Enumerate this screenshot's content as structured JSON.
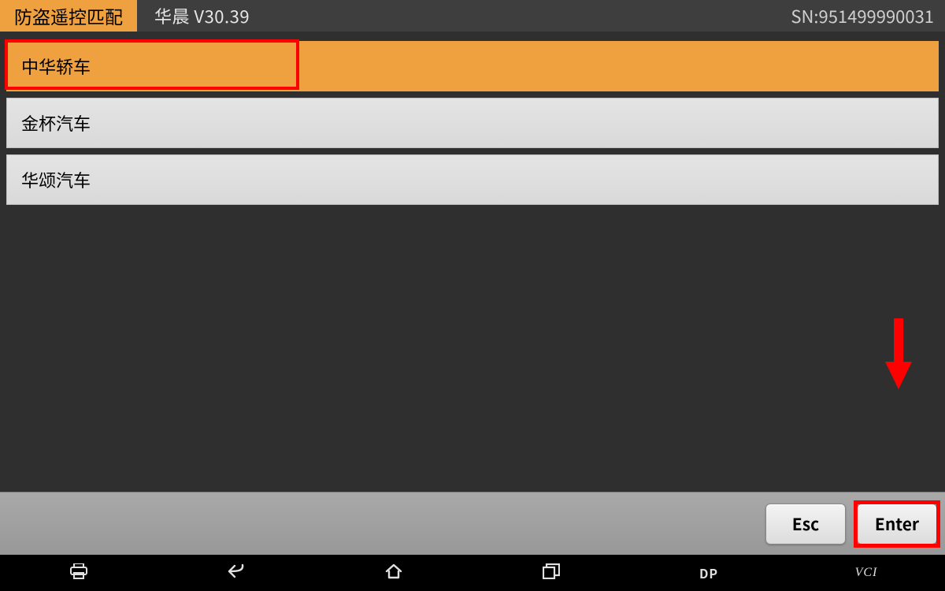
{
  "header": {
    "title": "防盗遥控匹配",
    "brand_version": "华晨  V30.39",
    "sn_label": "SN:951499990031"
  },
  "list": {
    "items": [
      {
        "label": "中华轿车",
        "selected": true
      },
      {
        "label": "金杯汽车",
        "selected": false
      },
      {
        "label": "华颂汽车",
        "selected": false
      }
    ]
  },
  "actions": {
    "esc": "Esc",
    "enter": "Enter"
  },
  "navbar": {
    "dp": "DP",
    "vci": "VCI"
  },
  "annotations": {
    "highlight_first_item": true,
    "highlight_enter_button": true,
    "arrow_to_enter": true
  },
  "colors": {
    "accent": "#efa03f",
    "highlight": "#ff0000"
  }
}
